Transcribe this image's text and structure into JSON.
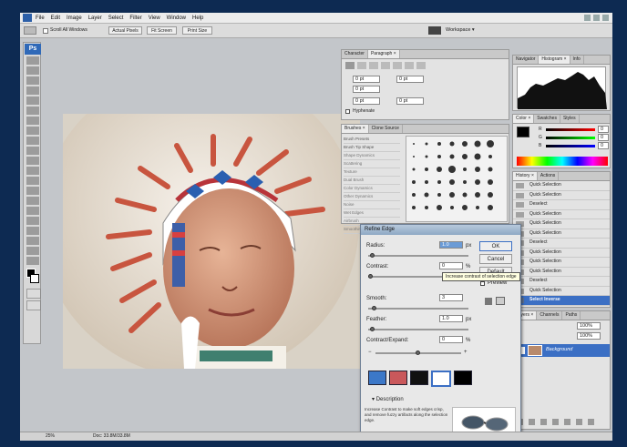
{
  "app": {
    "menu": [
      "File",
      "Edit",
      "Image",
      "Layer",
      "Select",
      "Filter",
      "View",
      "Window",
      "Help"
    ],
    "options_bar": {
      "checkbox_label": "Scroll All Windows",
      "buttons": [
        "Actual Pixels",
        "Fit Screen",
        "Print Size"
      ],
      "workspace": "Workspace ▾"
    },
    "tools_logo": "Ps"
  },
  "character_panel": {
    "tabs": [
      "Character",
      "Paragraph ×"
    ],
    "fields": [
      "0 pt",
      "0 pt",
      "0 pt",
      "0 pt",
      "0 pt",
      "0 pt"
    ],
    "hyphenate": "Hyphenate"
  },
  "brushes_panel": {
    "tabs": [
      "Brushes ×",
      "Clone Source"
    ],
    "items": [
      "Brush Presets",
      "Brush Tip Shape",
      "Shape Dynamics",
      "Scattering",
      "Texture",
      "Dual Brush",
      "Color Dynamics",
      "Other Dynamics",
      "Noise",
      "Wet Edges",
      "Airbrush",
      "Smoothing",
      "Protect Texture"
    ]
  },
  "navigator_panel": {
    "tabs": [
      "Navigator",
      "Histogram ×",
      "Info"
    ]
  },
  "color_panel": {
    "tabs": [
      "Color ×",
      "Swatches",
      "Styles"
    ],
    "channels": [
      "R",
      "G",
      "B"
    ],
    "values": [
      "0",
      "0",
      "0"
    ]
  },
  "history_panel": {
    "tabs": [
      "History ×",
      "Actions"
    ],
    "rows": [
      "Quick Selection",
      "Quick Selection",
      "Deselect",
      "Quick Selection",
      "Quick Selection",
      "Quick Selection",
      "Deselect",
      "Quick Selection",
      "Quick Selection",
      "Quick Selection",
      "Deselect",
      "Quick Selection",
      "Select Inverse"
    ]
  },
  "layers_panel": {
    "tabs": [
      "Layers ×",
      "Channels",
      "Paths"
    ],
    "opacity": "100%",
    "fill": "100%",
    "layer_name": "Background"
  },
  "refine_edge": {
    "title": "Refine Edge",
    "radius": {
      "label": "Radius:",
      "value": "1.0",
      "unit": "px"
    },
    "contrast": {
      "label": "Contrast:",
      "value": "0",
      "unit": "%"
    },
    "smooth": {
      "label": "Smooth:",
      "value": "3"
    },
    "feather": {
      "label": "Feather:",
      "value": "1.0",
      "unit": "px"
    },
    "contract": {
      "label": "Contract/Expand:",
      "value": "0",
      "unit": "%"
    },
    "minus": "−",
    "plus": "+",
    "ok": "OK",
    "cancel": "Cancel",
    "default": "Default",
    "preview": "Preview",
    "tooltip": "Increase contrast of selection edge",
    "description_label": "Description",
    "description_text": "Increase Contrast to make soft edges crisp, and remove fuzzy artifacts along the selection edge."
  },
  "status": {
    "zoom": "25%",
    "doc": "Doc: 33.8M/33.8M"
  },
  "colors": {
    "accent": "#2f69b8",
    "selected_row": "#3b6fc4",
    "desktop": "#0d2a52"
  }
}
